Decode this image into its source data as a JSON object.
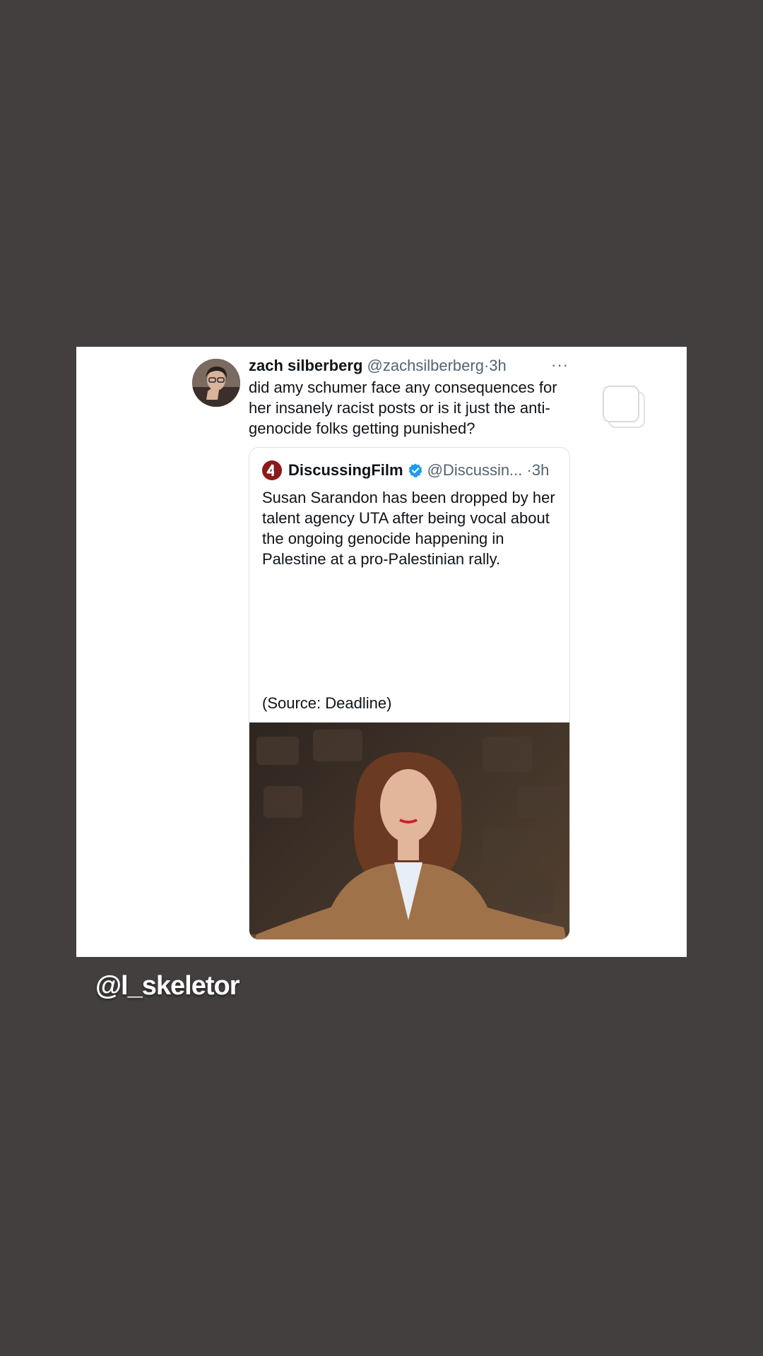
{
  "tweet": {
    "author_name": "zach silberberg",
    "author_handle": "@zachsilberberg",
    "separator": "·",
    "time": "3h",
    "more_icon": "more-dots-icon",
    "text": "did amy schumer face any consequences for her insanely racist posts or is it just the anti-genocide folks getting punished?"
  },
  "quoted_tweet": {
    "logo_icon": "discussingfilm-logo-icon",
    "author_name": "DiscussingFilm",
    "verified_icon": "verified-badge-icon",
    "author_handle": "@Discussin...",
    "separator": "·",
    "time": "3h",
    "text": "Susan Sarandon has been dropped by her talent agency UTA after being vocal about the ongoing genocide happening in Palestine at a pro-Palestinian rally.",
    "source": "(Source: Deadline)",
    "image": "photo-woman-fringed-jacket-balcony"
  },
  "story": {
    "copy_icon": "copy-icon",
    "mention": "@l_skeletor"
  },
  "colors": {
    "background": "#443f3f",
    "card": "#ffffff",
    "text_primary": "#0f1419",
    "text_secondary": "#536471",
    "verified": "#1d9bf0",
    "logo": "#8b1a1a"
  }
}
